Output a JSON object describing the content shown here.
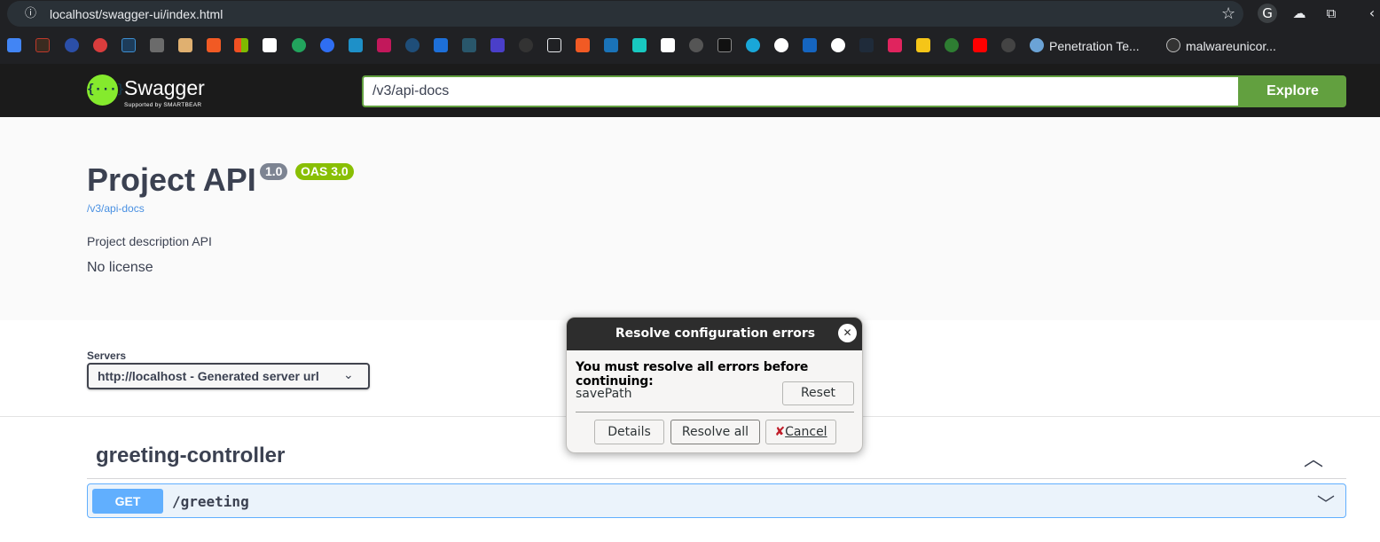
{
  "browser": {
    "url": "localhost/swagger-ui/index.html",
    "bookmarks": {
      "pentest_label": "Penetration Te...",
      "malware_label": "malwareunicor..."
    }
  },
  "topbar": {
    "logo_text": "Swagger",
    "logo_glyph": "{···}",
    "logo_sub": "Supported by SMARTBEAR",
    "explore_value": "/v3/api-docs",
    "explore_label": "Explore",
    "accent": "#62a03f",
    "logo_color": "#85ea2d"
  },
  "info": {
    "title": "Project API",
    "version": "1.0",
    "oas": "OAS 3.0",
    "spec_link": "/v3/api-docs",
    "description": "Project description API",
    "license": "No license"
  },
  "servers": {
    "label": "Servers",
    "selected": "http://localhost - Generated server url"
  },
  "tag": {
    "name": "greeting-controller"
  },
  "operation": {
    "method": "GET",
    "path": "/greeting",
    "method_color": "#61affe"
  },
  "dialog": {
    "title": "Resolve configuration errors",
    "message": "You must resolve all errors before continuing:",
    "item": "savePath",
    "reset_label": "Reset",
    "details_label": "Details",
    "resolve_all_label": "Resolve all",
    "cancel_label": "Cancel"
  }
}
